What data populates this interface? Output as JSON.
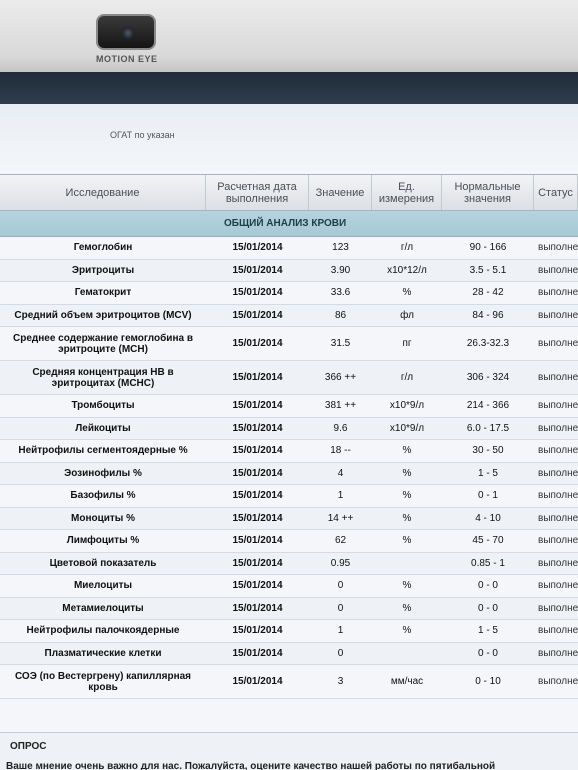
{
  "bezel": {
    "camera_label": "MOTION EYE"
  },
  "prev_row_text": "ОГАТ  по указан",
  "table": {
    "headers": {
      "name": "Исследование",
      "date": "Расчетная дата выполнения",
      "value": "Значение",
      "unit": "Ед. измерения",
      "norm": "Нормальные значения",
      "status": "Статус"
    },
    "section_title": "ОБЩИЙ АНАЛИЗ КРОВИ",
    "rows": [
      {
        "name": "Гемоглобин",
        "date": "15/01/2014",
        "value": "123",
        "unit": "г/л",
        "norm": "90 - 166",
        "status": "выполнено"
      },
      {
        "name": "Эритроциты",
        "date": "15/01/2014",
        "value": "3.90",
        "unit": "x10*12/л",
        "norm": "3.5 - 5.1",
        "status": "выполнено"
      },
      {
        "name": "Гематокрит",
        "date": "15/01/2014",
        "value": "33.6",
        "unit": "%",
        "norm": "28 - 42",
        "status": "выполнено"
      },
      {
        "name": "Средний объем эритроцитов (MCV)",
        "date": "15/01/2014",
        "value": "86",
        "unit": "фл",
        "norm": "84 - 96",
        "status": "выполнено"
      },
      {
        "name": "Среднее содержание гемоглобина в эритроците (MCH)",
        "date": "15/01/2014",
        "value": "31.5",
        "unit": "пг",
        "norm": "26.3-32.3",
        "status": "выполнено",
        "tall": true
      },
      {
        "name": "Средняя концентрация HB в эритроцитах (MCHC)",
        "date": "15/01/2014",
        "value": "366 ++",
        "unit": "г/л",
        "norm": "306 - 324",
        "status": "выполнено",
        "tall": true
      },
      {
        "name": "Тромбоциты",
        "date": "15/01/2014",
        "value": "381 ++",
        "unit": "x10*9/л",
        "norm": "214 - 366",
        "status": "выполнено"
      },
      {
        "name": "Лейкоциты",
        "date": "15/01/2014",
        "value": "9.6",
        "unit": "x10*9/л",
        "norm": "6.0 - 17.5",
        "status": "выполнено"
      },
      {
        "name": "Нейтрофилы сегментоядерные %",
        "date": "15/01/2014",
        "value": "18 --",
        "unit": "%",
        "norm": "30 - 50",
        "status": "выполнено"
      },
      {
        "name": "Эозинофилы %",
        "date": "15/01/2014",
        "value": "4",
        "unit": "%",
        "norm": "1 - 5",
        "status": "выполнено"
      },
      {
        "name": "Базофилы %",
        "date": "15/01/2014",
        "value": "1",
        "unit": "%",
        "norm": "0 - 1",
        "status": "выполнено"
      },
      {
        "name": "Моноциты %",
        "date": "15/01/2014",
        "value": "14 ++",
        "unit": "%",
        "norm": "4 - 10",
        "status": "выполнено"
      },
      {
        "name": "Лимфоциты %",
        "date": "15/01/2014",
        "value": "62",
        "unit": "%",
        "norm": "45 - 70",
        "status": "выполнено"
      },
      {
        "name": "Цветовой показатель",
        "date": "15/01/2014",
        "value": "0.95",
        "unit": "",
        "norm": "0.85 - 1",
        "status": "выполнено"
      },
      {
        "name": "Миелоциты",
        "date": "15/01/2014",
        "value": "0",
        "unit": "%",
        "norm": "0 - 0",
        "status": "выполнено"
      },
      {
        "name": "Метамиелоциты",
        "date": "15/01/2014",
        "value": "0",
        "unit": "%",
        "norm": "0 - 0",
        "status": "выполнено"
      },
      {
        "name": "Нейтрофилы палочкоядерные",
        "date": "15/01/2014",
        "value": "1",
        "unit": "%",
        "norm": "1 - 5",
        "status": "выполнено"
      },
      {
        "name": "Плазматические клетки",
        "date": "15/01/2014",
        "value": "0",
        "unit": "",
        "norm": "0 - 0",
        "status": "выполнено"
      },
      {
        "name": "СОЭ (по Вестергрену) капиллярная кровь",
        "date": "15/01/2014",
        "value": "3",
        "unit": "мм/час",
        "norm": "0 - 10",
        "status": "выполнено",
        "tall": true
      }
    ]
  },
  "survey": {
    "title": "ОПРОС",
    "text": "Ваше мнение очень важно для нас. Пожалуйста, оцените качество нашей работы по пятибальной"
  }
}
